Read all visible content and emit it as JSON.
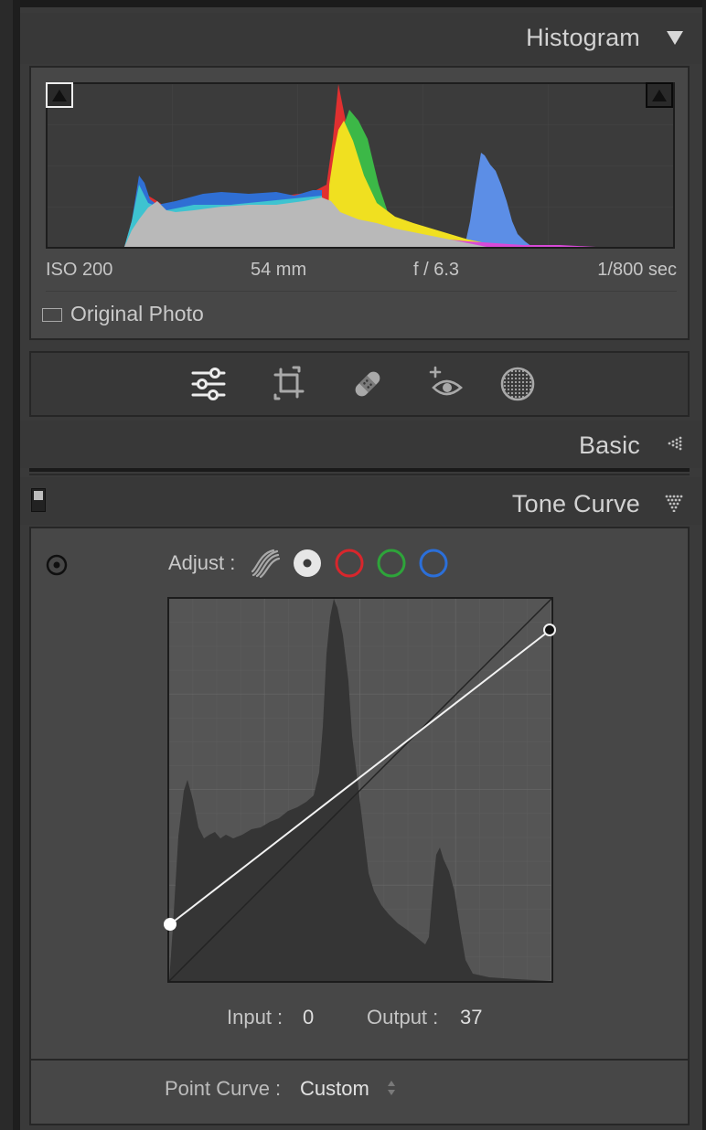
{
  "histogram": {
    "title": "Histogram",
    "exif": {
      "iso": "ISO 200",
      "focal_length": "54 mm",
      "aperture": "f / 6.3",
      "shutter": "1/800 sec"
    },
    "original_photo_label": "Original Photo"
  },
  "tools": [
    {
      "name": "edit-sliders-icon"
    },
    {
      "name": "crop-icon"
    },
    {
      "name": "healing-icon"
    },
    {
      "name": "red-eye-icon"
    },
    {
      "name": "masking-icon"
    }
  ],
  "basic": {
    "title": "Basic"
  },
  "tone_curve": {
    "title": "Tone Curve",
    "adjust_label": "Adjust :",
    "channels": [
      "parametric",
      "point-luminance",
      "red",
      "green",
      "blue"
    ],
    "channel_colors": {
      "red": "#d8262c",
      "green": "#2ea43a",
      "blue": "#2b6fd9"
    },
    "input_label": "Input :",
    "input_value": "0",
    "output_label": "Output :",
    "output_value": "37",
    "point_curve_label": "Point Curve :",
    "point_curve_value": "Custom"
  }
}
